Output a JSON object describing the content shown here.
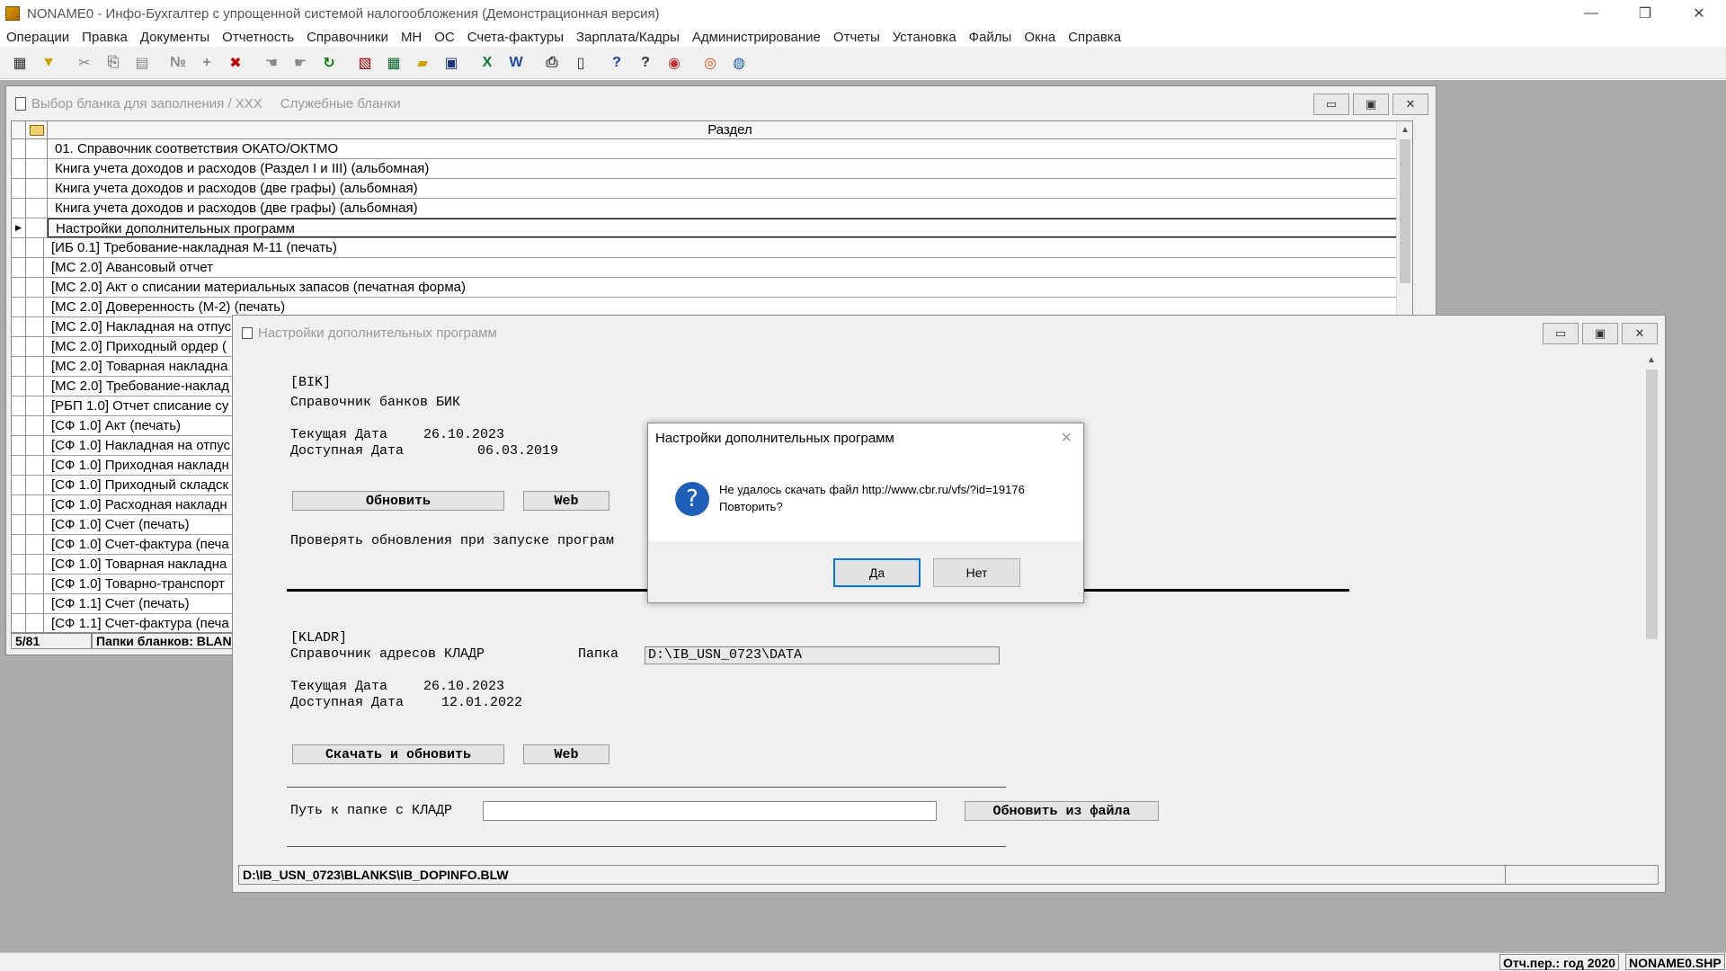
{
  "app": {
    "title": "NONAME0 - Инфо-Бухгалтер с упрощенной системой налогообложения (Демонстрационная версия)",
    "minimize": "—",
    "restore": "❐",
    "close": "✕"
  },
  "menu": [
    "Операции",
    "Правка",
    "Документы",
    "Отчетность",
    "Справочники",
    "МН",
    "ОС",
    "Счета-фактуры",
    "Зарплата/Кадры",
    "Администрирование",
    "Отчеты",
    "Установка",
    "Файлы",
    "Окна",
    "Справка"
  ],
  "toolbar": [
    {
      "name": "table-icon",
      "glyph": "▦",
      "color": "#333"
    },
    {
      "name": "filter-icon",
      "glyph": "▼",
      "color": "#c8a000"
    },
    {
      "sep": true
    },
    {
      "name": "cut-icon",
      "glyph": "✂",
      "color": "#888"
    },
    {
      "name": "copy-doc-icon",
      "glyph": "⎘",
      "color": "#888"
    },
    {
      "name": "paste-icon",
      "glyph": "▤",
      "color": "#888"
    },
    {
      "sep": true
    },
    {
      "name": "numbering-icon",
      "glyph": "№",
      "color": "#888"
    },
    {
      "name": "add-icon",
      "glyph": "+",
      "color": "#888"
    },
    {
      "name": "delete-icon",
      "glyph": "✖",
      "color": "#c00000"
    },
    {
      "sep": true
    },
    {
      "name": "select-icon",
      "glyph": "☚",
      "color": "#888"
    },
    {
      "name": "select-all-icon",
      "glyph": "☛",
      "color": "#888"
    },
    {
      "name": "refresh-icon",
      "glyph": "↻",
      "color": "#0a7a0a"
    },
    {
      "sep": true
    },
    {
      "name": "report-icon",
      "glyph": "▧",
      "color": "#a00000"
    },
    {
      "name": "calculator-icon",
      "glyph": "▦",
      "color": "#0a6a2a"
    },
    {
      "name": "open-folder-icon",
      "glyph": "▰",
      "color": "#d0a000"
    },
    {
      "name": "save-icon",
      "glyph": "▣",
      "color": "#203080"
    },
    {
      "sep": true
    },
    {
      "name": "excel-icon",
      "glyph": "X",
      "color": "#0a7a3a"
    },
    {
      "name": "word-icon",
      "glyph": "W",
      "color": "#1a4aa0"
    },
    {
      "sep": true
    },
    {
      "name": "print-icon",
      "glyph": "⎙",
      "color": "#333"
    },
    {
      "name": "preview-icon",
      "glyph": "▯",
      "color": "#333"
    },
    {
      "sep": true
    },
    {
      "name": "help-icon",
      "glyph": "?",
      "color": "#1a3aa0"
    },
    {
      "name": "context-help-icon",
      "glyph": "?",
      "color": "#333"
    },
    {
      "name": "compass-icon",
      "glyph": "◉",
      "color": "#c03030"
    },
    {
      "sep": true
    },
    {
      "name": "lifebuoy-icon",
      "glyph": "◎",
      "color": "#e05010"
    },
    {
      "name": "globe-icon",
      "glyph": "◍",
      "color": "#2060b0"
    }
  ],
  "win1": {
    "title": "Выбор бланка для заполнения / XXX",
    "title2": "Служебные бланки",
    "column": "Раздел",
    "rows": [
      {
        "text": "01. Справочник соответствия ОКАТО/ОКТМО",
        "indent": false
      },
      {
        "text": "Книга учета доходов и расходов (Раздел I и III) (альбомная)",
        "indent": false
      },
      {
        "text": "Книга учета доходов и расходов (две графы) (альбомная)",
        "indent": false
      },
      {
        "text": "Книга учета доходов и расходов (две графы) (альбомная)",
        "indent": false
      },
      {
        "text": "Настройки дополнительных программ",
        "indent": false,
        "selected": true
      },
      {
        "text": "[ИБ 0.1] Требование-накладная М-11 (печать)",
        "indent": true
      },
      {
        "text": "[МС 2.0] Авансовый отчет",
        "indent": true
      },
      {
        "text": "[МС 2.0] Акт о списании материальных запасов (печатная форма)",
        "indent": true
      },
      {
        "text": "[МС 2.0] Доверенность (М-2) (печать)",
        "indent": true
      },
      {
        "text": "[МС 2.0] Накладная на отпус",
        "indent": true
      },
      {
        "text": "[МС 2.0] Приходный ордер (",
        "indent": true
      },
      {
        "text": "[МС 2.0] Товарная накладна",
        "indent": true
      },
      {
        "text": "[МС 2.0] Требование-наклад",
        "indent": true
      },
      {
        "text": "[РБП 1.0] Отчет списание су",
        "indent": true
      },
      {
        "text": "[СФ 1.0] Акт (печать)",
        "indent": true
      },
      {
        "text": "[СФ 1.0] Накладная на отпус",
        "indent": true
      },
      {
        "text": "[СФ 1.0] Приходная накладн",
        "indent": true
      },
      {
        "text": "[СФ 1.0] Приходный складск",
        "indent": true
      },
      {
        "text": "[СФ 1.0] Расходная накладн",
        "indent": true
      },
      {
        "text": "[СФ 1.0] Счет (печать)",
        "indent": true
      },
      {
        "text": "[СФ 1.0] Счет-фактура (печа",
        "indent": true
      },
      {
        "text": "[СФ 1.0] Товарная накладна",
        "indent": true
      },
      {
        "text": "[СФ 1.0] Товарно-транспорт",
        "indent": true
      },
      {
        "text": "[СФ 1.1] Счет (печать)",
        "indent": true
      },
      {
        "text": "[СФ 1.1] Счет-фактура (печа",
        "indent": true
      }
    ],
    "status_count": "5/81",
    "status_folders": "Папки бланков: BLAN"
  },
  "win2": {
    "title": "Настройки дополнительных программ",
    "bik_tag": "[BIK]",
    "bik_name": "Справочник банков БИК",
    "bik_cur_label": "Текущая Дата",
    "bik_cur_value": "26.10.2023",
    "bik_avail_label": "Доступная Дата",
    "bik_avail_value": "06.03.2019",
    "btn_update": "Обновить",
    "btn_web": "Web",
    "check_updates": "Проверять обновления при запуске програм",
    "kladr_tag": "[KLADR]",
    "kladr_name": "Справочник адресов КЛАДР",
    "folder_label": "Папка",
    "folder_value": "D:\\IB_USN_0723\\DATA",
    "kladr_cur_label": "Текущая Дата",
    "kladr_cur_value": "26.10.2023",
    "kladr_avail_label": "Доступная Дата",
    "kladr_avail_value": "12.01.2022",
    "btn_download": "Скачать и обновить",
    "btn_web2": "Web",
    "path_label": "Путь к папке с КЛАДР",
    "path_value": "",
    "btn_from_file": "Обновить из файла",
    "status": "D:\\IB_USN_0723\\BLANKS\\IB_DOPINFO.BLW"
  },
  "dialog": {
    "title": "Настройки дополнительных программ",
    "close": "✕",
    "icon": "?",
    "line1": "Не удалось скачать файл http://www.cbr.ru/vfs/?id=19176",
    "line2": "Повторить?",
    "yes": "Да",
    "no": "Нет"
  },
  "statusbar": {
    "period": "Отч.пер.: год 2020",
    "file": "NONAME0.SHP"
  }
}
